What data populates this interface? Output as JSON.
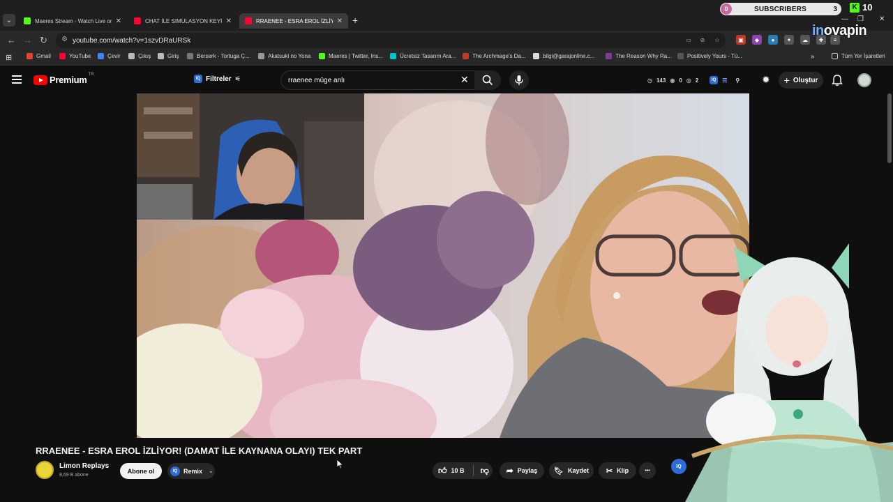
{
  "browser": {
    "tabs": [
      {
        "title": "Maeres Stream - Watch Live on Kick",
        "favicon_color": "#53fc18",
        "active": false
      },
      {
        "title": "CHAT İLE SIMULASYON KEYFİ | ...",
        "favicon_color": "#ff0033",
        "active": false
      },
      {
        "title": "RRAENEE - ESRA EROL İZLİYOR!...",
        "favicon_color": "#ff0033",
        "active": true
      }
    ],
    "new_tab": "+",
    "url": "youtube.com/watch?v=1szvDRaURSk",
    "bookmarks": [
      {
        "label": "Gmail",
        "color": "#ea4335"
      },
      {
        "label": "YouTube",
        "color": "#ff0033"
      },
      {
        "label": "Çevir",
        "color": "#4285f4"
      },
      {
        "label": "Çıkış",
        "color": "#bbbbbb"
      },
      {
        "label": "Giriş",
        "color": "#bbbbbb"
      },
      {
        "label": "Berserk - Tortuga Ç...",
        "color": "#777777"
      },
      {
        "label": "Akatsuki no Yona",
        "color": "#999999"
      },
      {
        "label": "Maeres | Twitter, Ins...",
        "color": "#53fc18"
      },
      {
        "label": "Ücretsiz Tasarım Ara...",
        "color": "#00c4cc"
      },
      {
        "label": "The Archmage's Da...",
        "color": "#c0392b"
      },
      {
        "label": "bilgi@garajonline.c...",
        "color": "#dddddd"
      },
      {
        "label": "The Reason Why Ra...",
        "color": "#7d3c98"
      },
      {
        "label": "Positively Yours - Tü...",
        "color": "#555555"
      }
    ],
    "all_bookmarks": "Tüm Yer İşaretleri",
    "more_bookmarks": "»"
  },
  "overlay": {
    "sub_zero": "0",
    "subscribers_label": "SUBSCRIBERS",
    "subscribers_count": "3",
    "kick_count": "10",
    "kick_letter": "K",
    "sponsor_prefix": "in",
    "sponsor_suffix": "ovapin"
  },
  "youtube": {
    "logo_text": "Premium",
    "region": "TR",
    "filters_label": "Filtreler",
    "iq_label": "IQ",
    "search_value": "rraenee müge anlı",
    "stats": {
      "clock": "143",
      "eye": "0",
      "views": "2"
    },
    "create_label": "Oluştur"
  },
  "video": {
    "title": "RRAENEE - ESRA EROL İZLİYOR! (DAMAT İLE KAYNANA OLAYI) TEK PART",
    "channel": "Limon Replays",
    "subscribers": "8,69 B abone",
    "subscribe_label": "Abone ol",
    "remix_label": "Remix",
    "likes": "10 B",
    "share_label": "Paylaş",
    "save_label": "Kaydet",
    "clip_label": "Klip",
    "more_label": "•••"
  }
}
